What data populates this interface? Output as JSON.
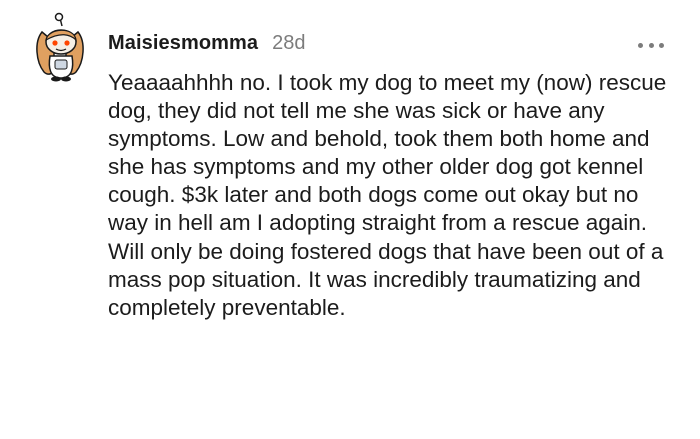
{
  "comment": {
    "username": "Maisiesmomma",
    "age": "28d",
    "body": "Yeaaaahhhh no. I took my dog to meet my (now) rescue dog, they did not tell me she was sick or have any symptoms. Low and behold, took them both home and she has symptoms and my other older dog got kennel cough. $3k later and both dogs come out okay but no way in hell am I adopting straight from a rescue again. Will only be doing fostered dogs that have been out of a mass pop situation. It was incredibly traumatizing and completely preventable.",
    "avatar_icon": "snoo-avatar-icon",
    "more_icon": "more-options-icon"
  },
  "colors": {
    "text": "#1c1c1c",
    "meta": "#7c7c7c",
    "avatar_hair": "#e0a060",
    "avatar_face": "#f5efe6",
    "avatar_eyes": "#ff4500"
  }
}
